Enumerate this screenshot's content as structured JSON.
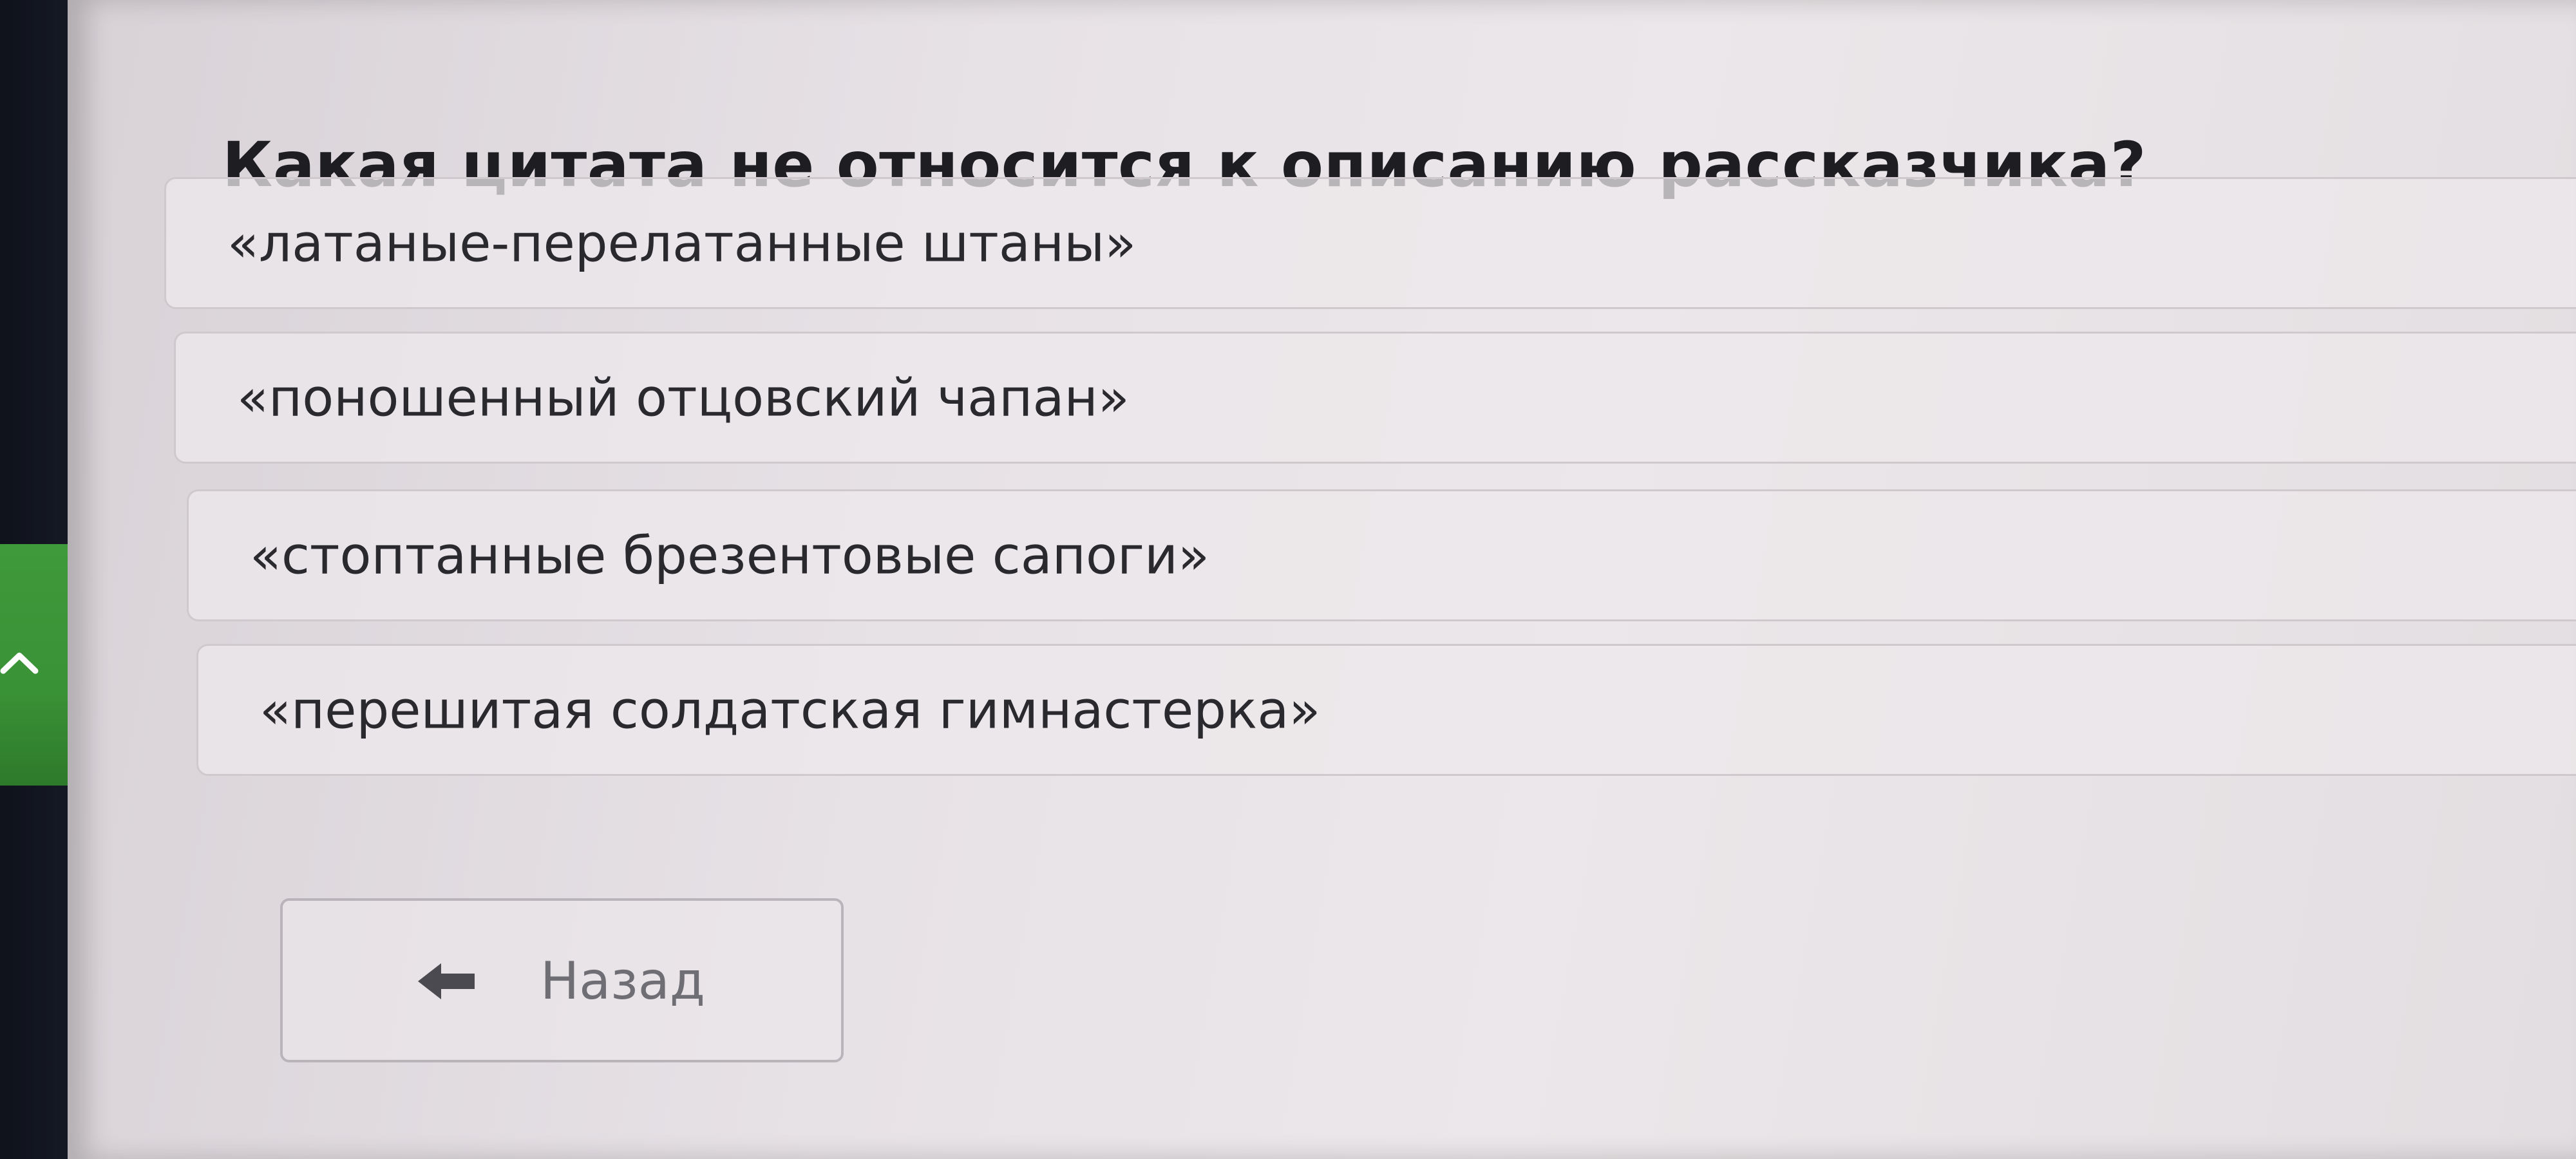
{
  "question": {
    "text": "Какая цитата не относится к описанию рассказчика?"
  },
  "options": [
    {
      "label": "«латаные-перелатанные штаны»"
    },
    {
      "label": "«поношенный отцовский чапан»"
    },
    {
      "label": "«стоптанные брезентовые сапоги»"
    },
    {
      "label": "«перешитая солдатская гимнастерка»"
    }
  ],
  "navigation": {
    "back_label": "Назад",
    "back_icon": "arrow-left-icon",
    "collapse_icon": "chevron-up-icon"
  },
  "colors": {
    "sidebar_accent": "#3f9a3b",
    "text": "#2a2a2e",
    "muted_text": "#6e6e74"
  }
}
